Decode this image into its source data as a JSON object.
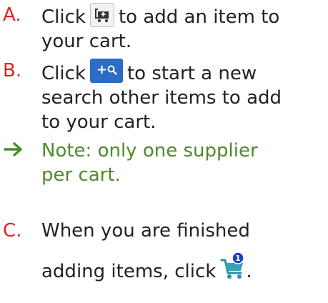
{
  "steps": [
    {
      "marker": "A.",
      "line1_before": "Click",
      "line1_after": "to add an item to",
      "line2": "your cart.",
      "icon": "add-to-cart-icon"
    },
    {
      "marker": "B.",
      "line1_before": "Click",
      "line1_after": "to start a new",
      "line2": "search other items to add",
      "line3": "to your cart.",
      "icon": "new-search-button",
      "button_label": "+"
    },
    {
      "marker": "C.",
      "line1": "When you are finished",
      "line2_before": "adding items, click",
      "line2_after": ".",
      "icon": "cart-icon",
      "badge": "1"
    }
  ],
  "note": {
    "icon": "arrow-right-icon",
    "line1": "Note: only one supplier",
    "line2": "per cart."
  },
  "colors": {
    "marker": "#e8201e",
    "note": "#4e8a2a",
    "search_button": "#2b6cc4",
    "badge": "#1a3fbf",
    "cart": "#2f8fa8"
  }
}
